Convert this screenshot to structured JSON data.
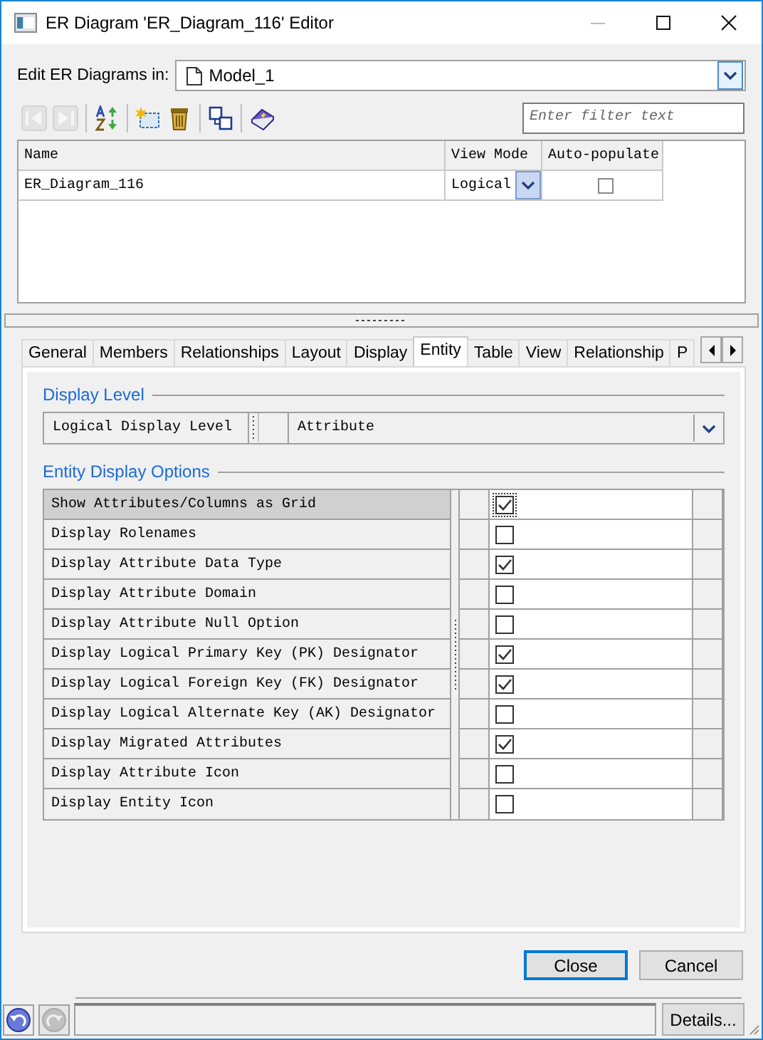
{
  "window": {
    "title": "ER Diagram 'ER_Diagram_116' Editor"
  },
  "model_picker": {
    "label": "Edit ER Diagrams in:",
    "value": "Model_1"
  },
  "toolbar": [
    {
      "kind": "back",
      "disabled": true
    },
    {
      "kind": "forward",
      "disabled": true
    },
    {
      "kind": "sort",
      "disabled": false
    },
    {
      "kind": "new",
      "disabled": false
    },
    {
      "kind": "delete",
      "disabled": false
    },
    {
      "kind": "copy",
      "disabled": false
    },
    {
      "kind": "book",
      "disabled": false
    }
  ],
  "filter": {
    "placeholder": "Enter filter text"
  },
  "diagrams_table": {
    "columns": [
      "Name",
      "View Mode",
      "Auto-populate"
    ],
    "rows": [
      {
        "name": "ER_Diagram_116",
        "view_mode": "Logical",
        "auto_populate": false
      }
    ]
  },
  "tabs": [
    {
      "label": "General",
      "selected": false
    },
    {
      "label": "Members",
      "selected": false
    },
    {
      "label": "Relationships",
      "selected": false
    },
    {
      "label": "Layout",
      "selected": false
    },
    {
      "label": "Display",
      "selected": false
    },
    {
      "label": "Entity",
      "selected": true
    },
    {
      "label": "Table",
      "selected": false
    },
    {
      "label": "View",
      "selected": false
    },
    {
      "label": "Relationship",
      "selected": false
    },
    {
      "label": "P",
      "selected": false
    }
  ],
  "display_level": {
    "heading": "Display Level",
    "label": "Logical Display Level",
    "value": "Attribute"
  },
  "entity_options": {
    "heading": "Entity Display Options",
    "rows": [
      {
        "label": "Show Attributes/Columns as Grid",
        "checked": true,
        "selected": true
      },
      {
        "label": "Display Rolenames",
        "checked": false,
        "selected": false
      },
      {
        "label": "Display Attribute Data Type",
        "checked": true,
        "selected": false
      },
      {
        "label": "Display Attribute Domain",
        "checked": false,
        "selected": false
      },
      {
        "label": "Display Attribute Null Option",
        "checked": false,
        "selected": false
      },
      {
        "label": "Display Logical Primary Key (PK) Designator",
        "checked": true,
        "selected": false
      },
      {
        "label": "Display Logical Foreign Key (FK) Designator",
        "checked": true,
        "selected": false
      },
      {
        "label": "Display Logical Alternate Key (AK) Designator",
        "checked": false,
        "selected": false
      },
      {
        "label": "Display Migrated Attributes",
        "checked": true,
        "selected": false
      },
      {
        "label": "Display Attribute Icon",
        "checked": false,
        "selected": false
      },
      {
        "label": "Display Entity Icon",
        "checked": false,
        "selected": false
      }
    ]
  },
  "buttons": [
    {
      "label": "Close",
      "default": true
    },
    {
      "label": "Cancel",
      "default": false
    }
  ],
  "status_bar": {
    "history": [
      {
        "kind": "undo",
        "disabled": false
      },
      {
        "kind": "redo",
        "disabled": true
      }
    ],
    "details": "Details..."
  }
}
